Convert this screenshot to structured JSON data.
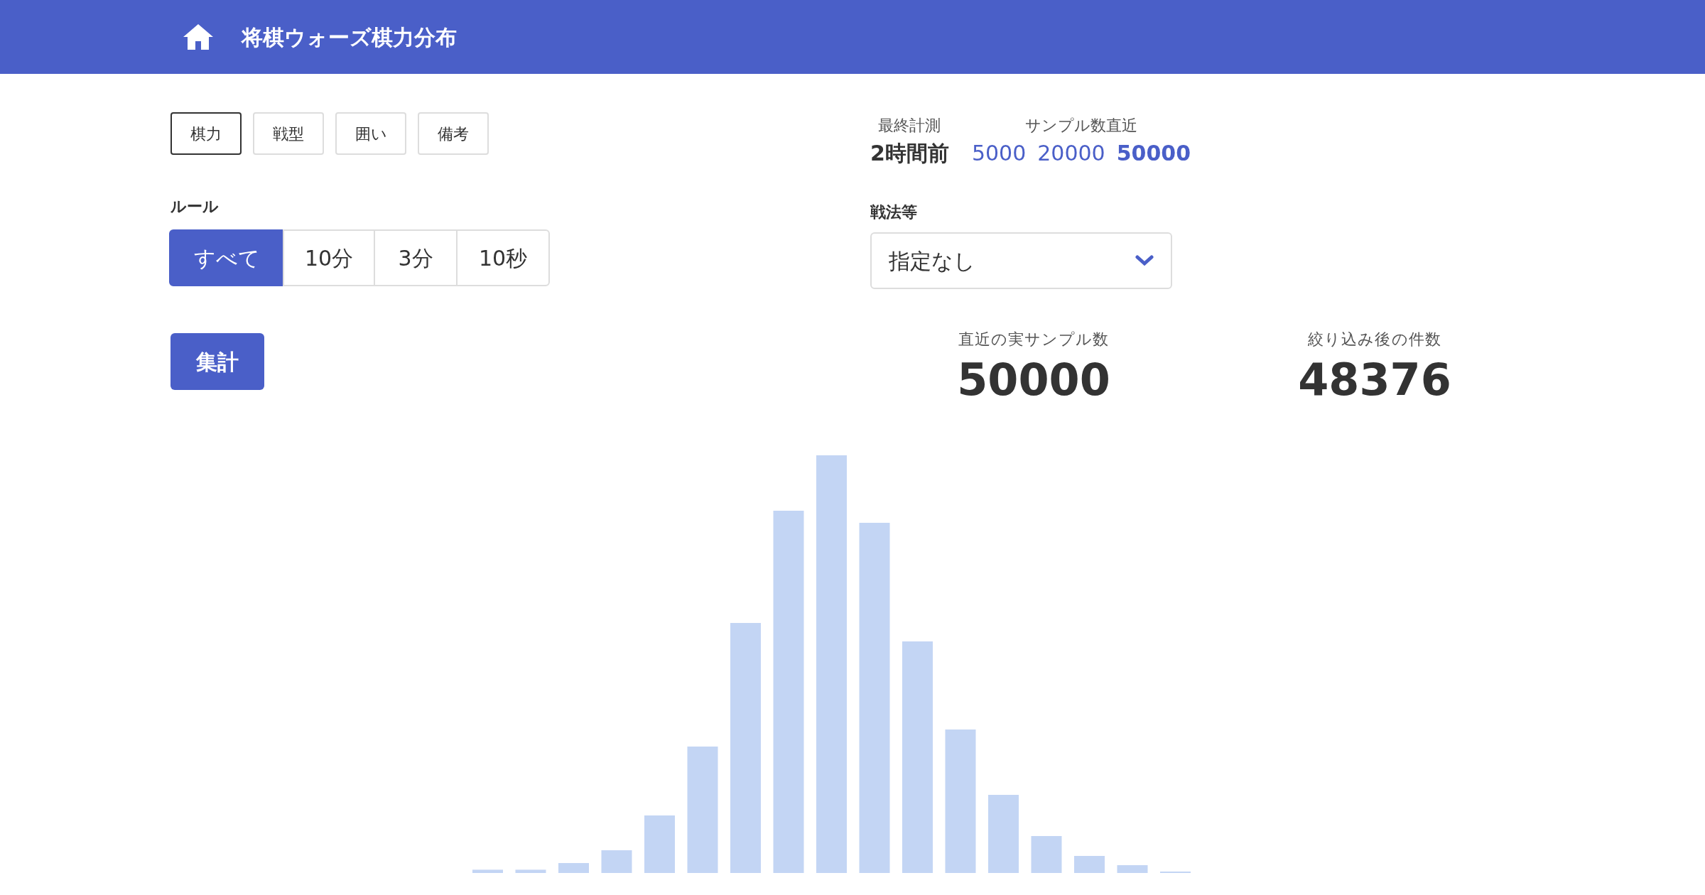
{
  "header": {
    "title": "将棋ウォーズ棋力分布"
  },
  "tabs": [
    {
      "label": "棋力",
      "selected": true
    },
    {
      "label": "戦型",
      "selected": false
    },
    {
      "label": "囲い",
      "selected": false
    },
    {
      "label": "備考",
      "selected": false
    }
  ],
  "rule": {
    "label": "ルール",
    "options": [
      {
        "label": "すべて",
        "selected": true
      },
      {
        "label": "10分",
        "selected": false
      },
      {
        "label": "3分",
        "selected": false
      },
      {
        "label": "10秒",
        "selected": false
      }
    ]
  },
  "aggregate_button": "集計",
  "last_measured": {
    "label": "最終計測",
    "value": "2時間前"
  },
  "sample_size": {
    "label": "サンプル数直近",
    "options": [
      {
        "label": "5000",
        "selected": false
      },
      {
        "label": "20000",
        "selected": false
      },
      {
        "label": "50000",
        "selected": true
      }
    ]
  },
  "strategy": {
    "label": "戦法等",
    "value": "指定なし"
  },
  "stats": [
    {
      "label": "直近の実サンプル数",
      "value": "50000"
    },
    {
      "label": "絞り込み後の件数",
      "value": "48376"
    }
  ]
}
